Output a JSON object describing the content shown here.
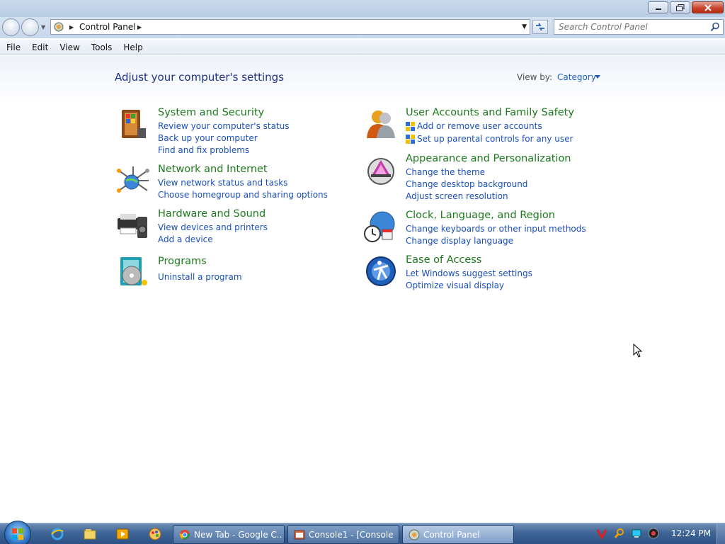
{
  "address": {
    "breadcrumb": "Control Panel"
  },
  "search": {
    "placeholder": "Search Control Panel"
  },
  "menu": [
    "File",
    "Edit",
    "View",
    "Tools",
    "Help"
  ],
  "header": {
    "title": "Adjust your computer's settings",
    "view_by_label": "View by:",
    "view_by_value": "Category"
  },
  "categories": {
    "system_security": {
      "title": "System and Security",
      "links": [
        "Review your computer's status",
        "Back up your computer",
        "Find and fix problems"
      ]
    },
    "network": {
      "title": "Network and Internet",
      "links": [
        "View network status and tasks",
        "Choose homegroup and sharing options"
      ]
    },
    "hardware": {
      "title": "Hardware and Sound",
      "links": [
        "View devices and printers",
        "Add a device"
      ]
    },
    "programs": {
      "title": "Programs",
      "links": [
        "Uninstall a program"
      ]
    },
    "user_accounts": {
      "title": "User Accounts and Family Safety",
      "links": [
        "Add or remove user accounts",
        "Set up parental controls for any user"
      ]
    },
    "appearance": {
      "title": "Appearance and Personalization",
      "links": [
        "Change the theme",
        "Change desktop background",
        "Adjust screen resolution"
      ]
    },
    "clock": {
      "title": "Clock, Language, and Region",
      "links": [
        "Change keyboards or other input methods",
        "Change display language"
      ]
    },
    "ease": {
      "title": "Ease of Access",
      "links": [
        "Let Windows suggest settings",
        "Optimize visual display"
      ]
    }
  },
  "taskbar": {
    "tasks": [
      "New Tab - Google C...",
      "Console1 - [Console ...",
      "Control Panel"
    ],
    "clock": "12:24 PM"
  }
}
